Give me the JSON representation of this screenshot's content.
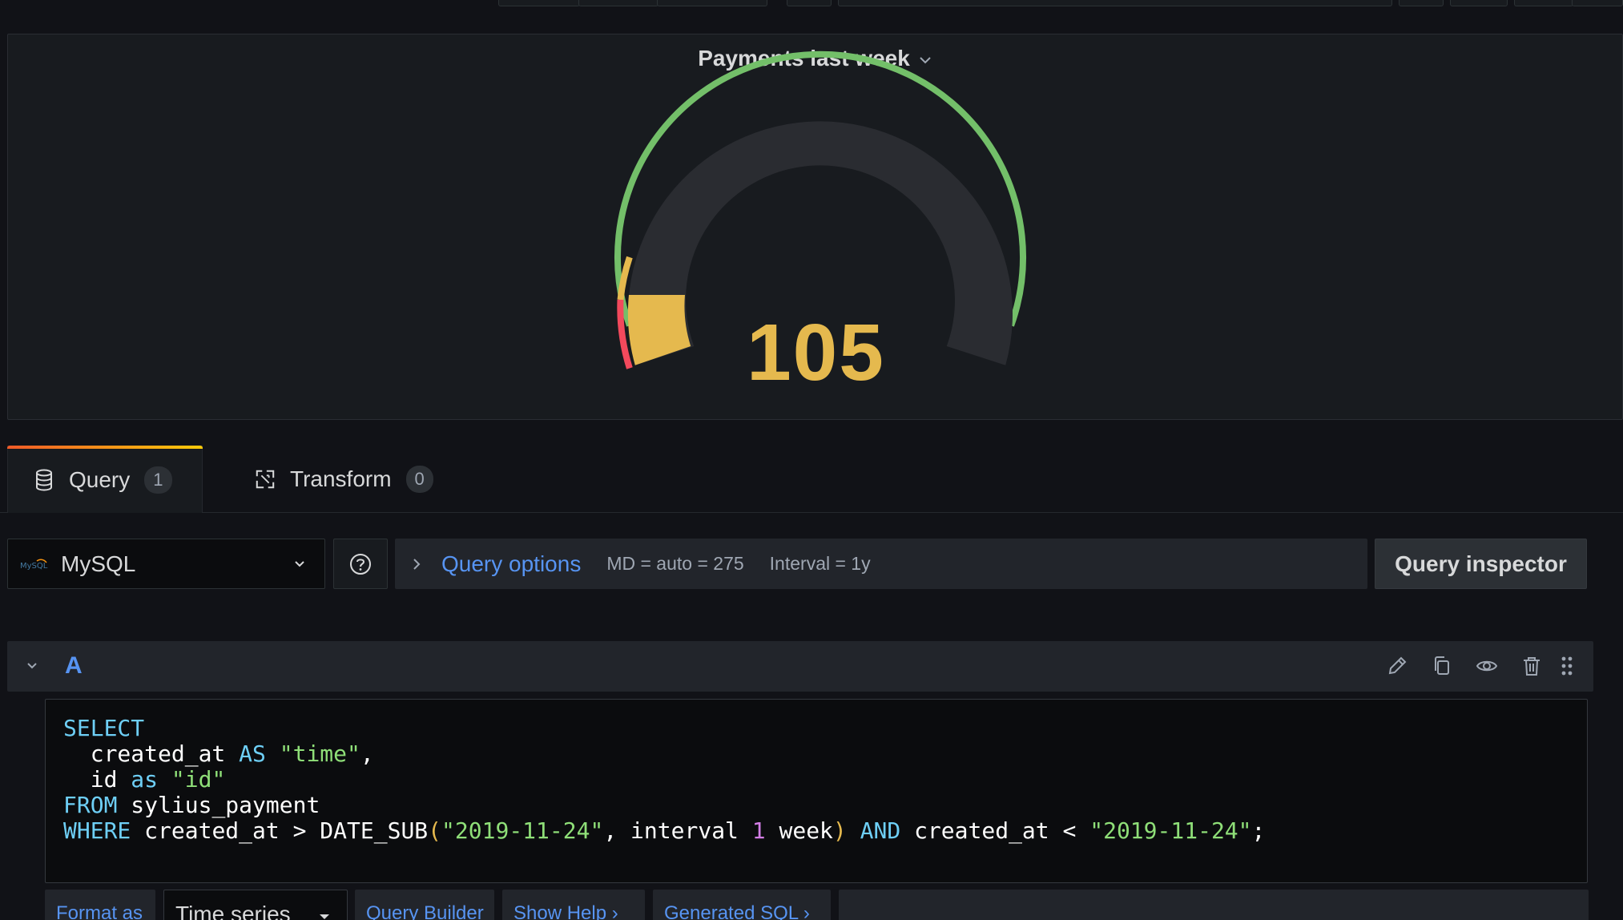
{
  "panel": {
    "title": "Payments last week",
    "gauge": {
      "value": "105",
      "value_numeric": 105,
      "thresholds": [
        {
          "color": "#f2495c"
        },
        {
          "color": "#e5b94e"
        },
        {
          "color": "#73bf69"
        }
      ],
      "value_color": "#e5b94e"
    }
  },
  "tabs": [
    {
      "label": "Query",
      "count": "1"
    },
    {
      "label": "Transform",
      "count": "0"
    }
  ],
  "datasource": {
    "name": "MySQL",
    "logo_text": "MySQL"
  },
  "query_options": {
    "label": "Query options",
    "md": "MD = auto = 275",
    "interval": "Interval = 1y"
  },
  "query_inspector": {
    "label": "Query inspector"
  },
  "query_row": {
    "ref_id": "A"
  },
  "sql": {
    "line1_kw": "SELECT",
    "line2_a": "  created_at ",
    "line2_kw": "AS",
    "line2_str": "\"time\"",
    "line2_end": ",",
    "line3_a": "  id ",
    "line3_kw": "as",
    "line3_str": "\"id\"",
    "line4_kw": "FROM",
    "line4_rest": " sylius_payment",
    "line5_kw": "WHERE",
    "line5_a": " created_at > DATE_SUB",
    "line5_p1": "(",
    "line5_str1": "\"2019-11-24\"",
    "line5_b": ", interval ",
    "line5_num": "1",
    "line5_c": " week",
    "line5_p2": ")",
    "line5_kw2": " AND",
    "line5_d": " created_at < ",
    "line5_str2": "\"2019-11-24\"",
    "line5_end": ";"
  },
  "bottom": {
    "format_as": "Format as",
    "format_value": "Time series",
    "query_builder": "Query Builder",
    "show_help": "Show Help ›",
    "generated_sql": "Generated SQL ›"
  },
  "colors": {
    "accent": "#5794f2",
    "background": "#111217",
    "panel": "#181b1f"
  }
}
